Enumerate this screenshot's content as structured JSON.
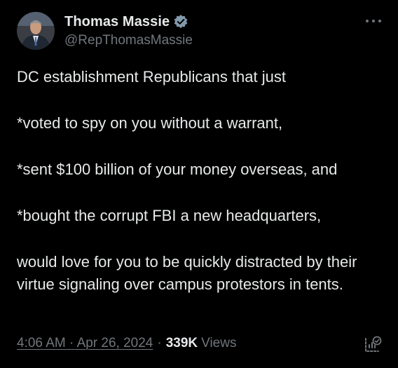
{
  "author": {
    "display_name": "Thomas Massie",
    "handle": "@RepThomasMassie",
    "verified_icon": "verified-badge-icon",
    "avatar": "avatar"
  },
  "tweet": {
    "paragraphs": [
      "DC establishment Republicans  that just",
      "*voted to spy on you without a warrant,",
      "*sent $100 billion of your money overseas, and",
      "*bought the corrupt FBI a new headquarters,",
      "would love for you to be quickly distracted by their virtue signaling over campus protestors in tents."
    ],
    "time": "4:06 AM",
    "date_sep": "·",
    "date": "Apr 26, 2024",
    "views_sep": "·",
    "views_count": "339K",
    "views_label": "Views"
  },
  "icons": {
    "more": "more-options-icon",
    "analytics": "post-analytics-icon"
  },
  "colors": {
    "background": "#000000",
    "primary_text": "#e7e9ea",
    "secondary_text": "#71767b",
    "verified": "#829aab"
  }
}
